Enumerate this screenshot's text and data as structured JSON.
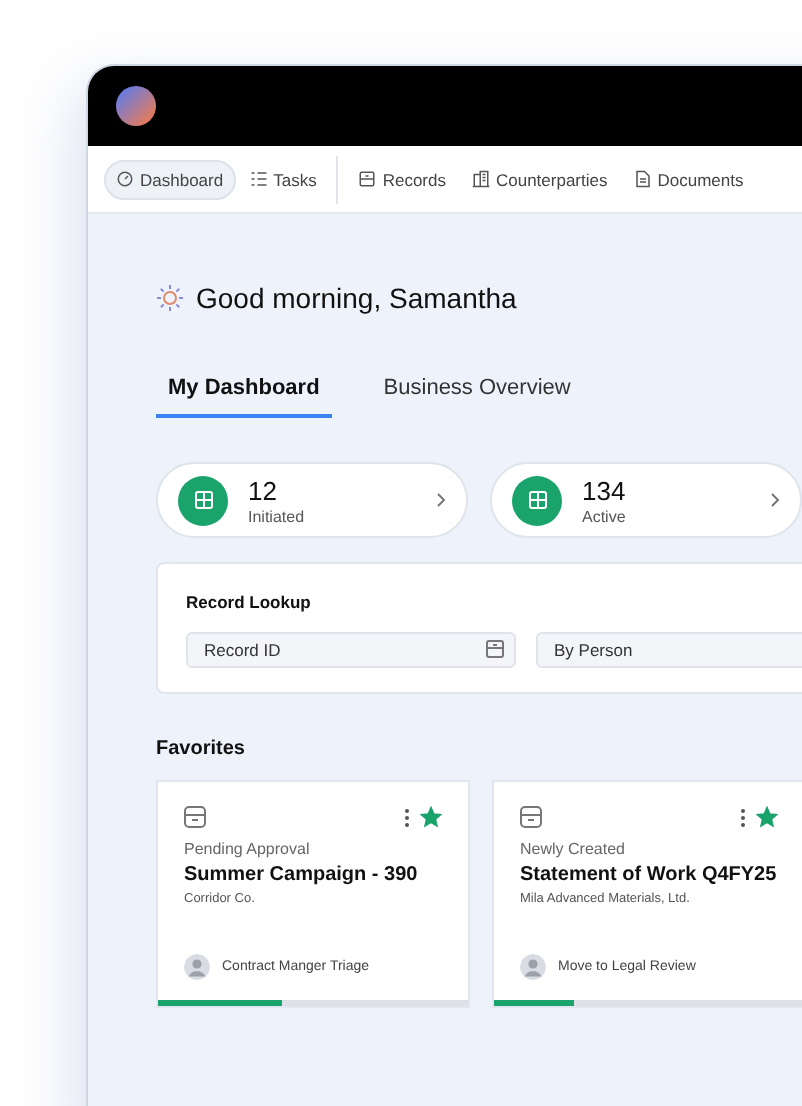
{
  "nav": [
    {
      "label": "Dashboard",
      "kind": "dashboard",
      "selected": true
    },
    {
      "label": "Tasks",
      "kind": "tasks",
      "selected": false
    },
    {
      "label": "Records",
      "kind": "records",
      "selected": false
    },
    {
      "label": "Counterparties",
      "kind": "building",
      "selected": false
    },
    {
      "label": "Documents",
      "kind": "document",
      "selected": false
    }
  ],
  "greeting": "Good morning, Samantha",
  "tabs": [
    {
      "label": "My Dashboard",
      "selected": true
    },
    {
      "label": "Business Overview",
      "selected": false
    }
  ],
  "stats": [
    {
      "value": "12",
      "label": "Initiated"
    },
    {
      "value": "134",
      "label": "Active"
    }
  ],
  "record_lookup": {
    "title": "Record Lookup",
    "fields": [
      {
        "placeholder": "Record ID"
      },
      {
        "placeholder": "By Person"
      }
    ]
  },
  "favorites": {
    "title": "Favorites",
    "cards": [
      {
        "status": "Pending Approval",
        "title": "Summer Campaign - 390",
        "company": "Corridor Co.",
        "step": "Contract Manger Triage",
        "starred": true,
        "level": 0.4
      },
      {
        "status": "Newly Created",
        "title": "Statement of Work Q4FY25",
        "company": "Mila Advanced Materials, Ltd.",
        "step": "Move to Legal Review",
        "starred": true,
        "level": 0.26
      }
    ]
  }
}
